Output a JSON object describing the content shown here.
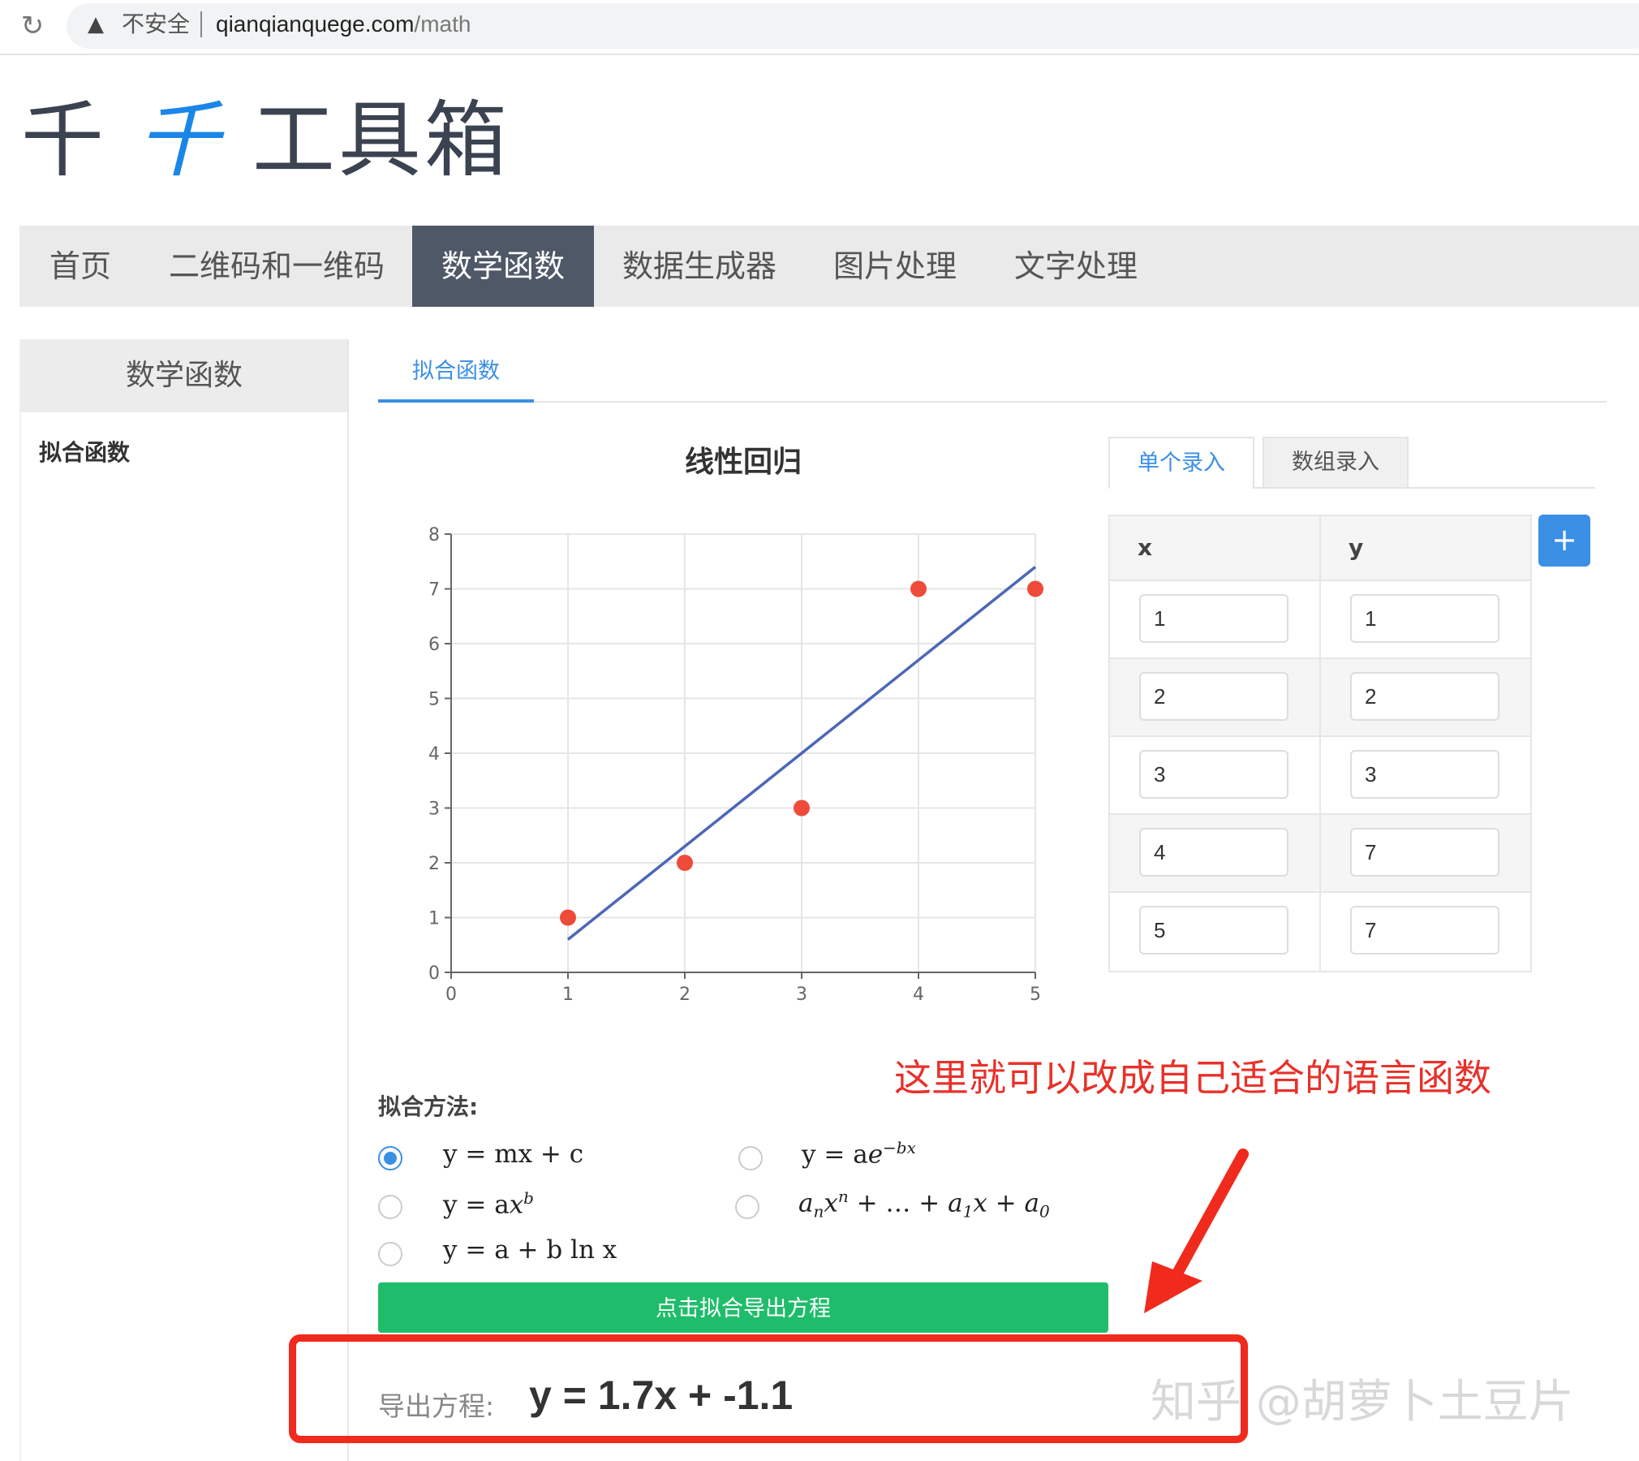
{
  "browser": {
    "security_label": "不安全",
    "url_host": "qianqianquege.com",
    "url_path": "/math"
  },
  "logo": {
    "part1": "千",
    "accent": "千",
    "part2": " 工具箱"
  },
  "top_nav": {
    "items": [
      "首页",
      "二维码和一维码",
      "数学函数",
      "数据生成器",
      "图片处理",
      "文字处理"
    ],
    "active": "数学函数"
  },
  "sidebar": {
    "title": "数学函数",
    "items": [
      "拟合函数"
    ]
  },
  "content_tab": "拟合函数",
  "chart_data": {
    "type": "scatter",
    "title": "线性回归",
    "xlim": [
      0,
      5
    ],
    "ylim": [
      0,
      8
    ],
    "x_ticks": [
      "0",
      "1",
      "2",
      "3",
      "4",
      "5"
    ],
    "y_ticks": [
      "0",
      "1",
      "2",
      "3",
      "4",
      "5",
      "6",
      "7",
      "8"
    ],
    "grid": true,
    "series": [
      {
        "x": [
          1,
          2,
          3,
          4,
          5
        ],
        "y": [
          1,
          2,
          3,
          7,
          7
        ],
        "color": "#ee4b3a"
      }
    ],
    "fit_line": {
      "x": [
        1,
        5
      ],
      "y": [
        0.6,
        7.4
      ],
      "color": "#4b67b6"
    }
  },
  "entry_tabs": {
    "single": "单个录入",
    "array": "数组录入"
  },
  "data_table": {
    "headers": [
      "x",
      "y"
    ],
    "rows": [
      {
        "x": "1",
        "y": "1"
      },
      {
        "x": "2",
        "y": "2"
      },
      {
        "x": "3",
        "y": "3"
      },
      {
        "x": "4",
        "y": "7"
      },
      {
        "x": "5",
        "y": "7"
      }
    ],
    "add_label": "+"
  },
  "annotation": "这里就可以改成自己适合的语言函数",
  "fit_method": {
    "label": "拟合方法:",
    "selected": "linear"
  },
  "fit_button": "点击拟合导出方程",
  "result": {
    "label": "导出方程:",
    "equation": "y = 1.7x + -1.1"
  },
  "watermark": "知乎 @胡萝卜土豆片",
  "colors": {
    "accent": "#3b8fe5",
    "nav_active": "#4f5867",
    "fit_button": "#1fbd6b",
    "annotation": "#e8312a"
  }
}
